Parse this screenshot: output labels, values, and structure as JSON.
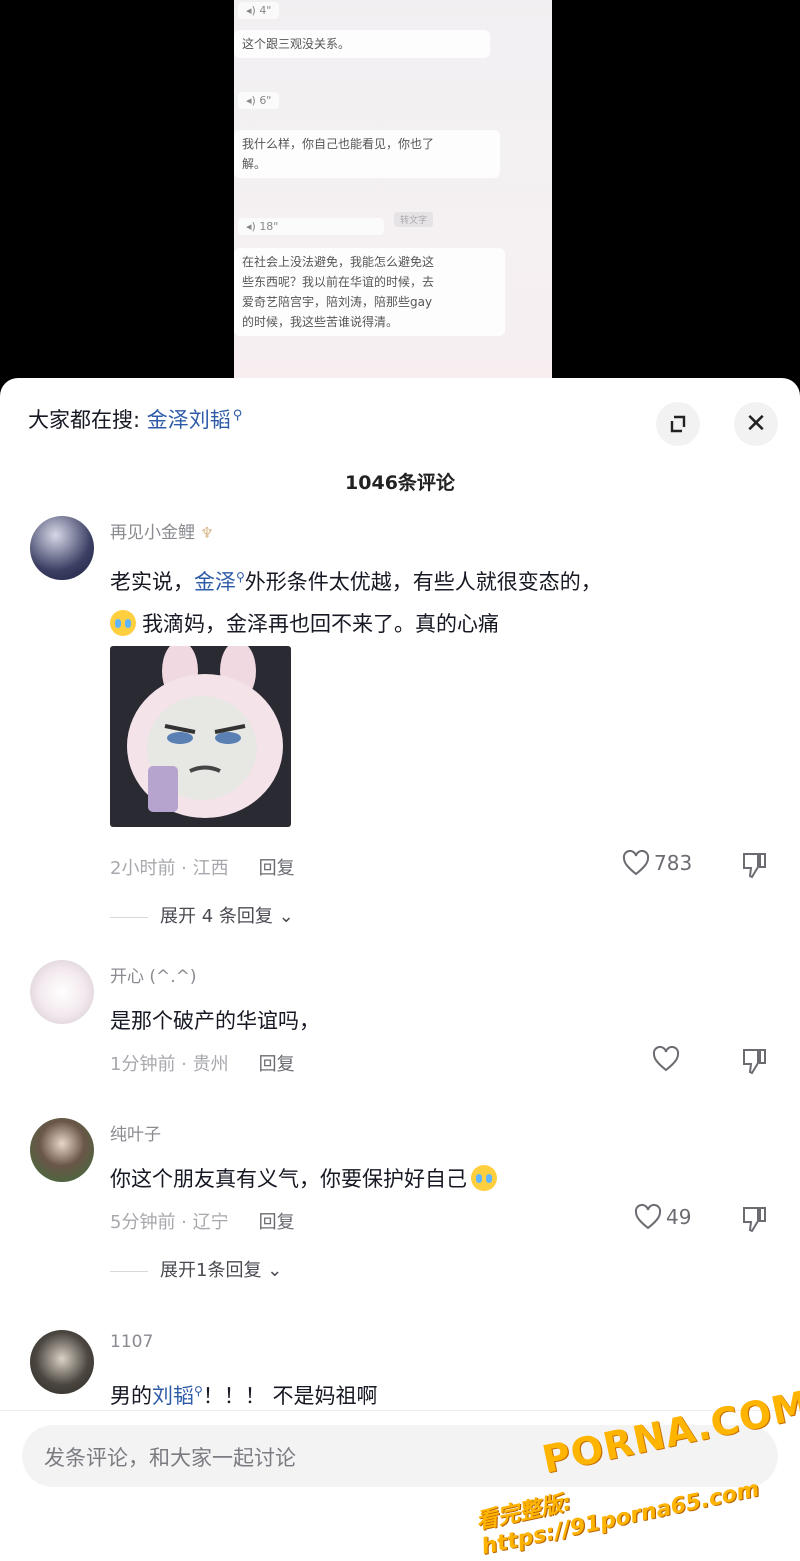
{
  "video": {
    "voice_1": "4\"",
    "msg_1": "这个跟三观没关系。",
    "voice_2": "6\"",
    "msg_2_line1": "我什么样，你自己也能看见，你也了",
    "msg_2_line2": "解。",
    "voice_3": "18\"",
    "tag_3": "转文字",
    "msg_3_line1": "在社会上没法避免，我能怎么避免这",
    "msg_3_line2": "些东西呢？我以前在华谊的时候，去",
    "msg_3_line3": "爱奇艺陪宫宇，陪刘涛，陪那些gay",
    "msg_3_line4": "的时候，我这些苦谁说得清。"
  },
  "header": {
    "search_prefix": "大家都在搜:",
    "search_keyword": "金泽刘韬",
    "comment_count_title": "1046条评论"
  },
  "comments": [
    {
      "username": "再见小金鲤",
      "text_before": "老实说，",
      "text_keyword": "金泽",
      "text_after": "外形条件太优越，有些人就很变态的，",
      "text_line2": "我滴妈，金泽再也回不来了。真的心痛",
      "meta": "2小时前 · 江西",
      "reply_label": "回复",
      "likes": "783",
      "expand_label": "展开 4 条回复"
    },
    {
      "username": "开心 (^.^)",
      "text": "是那个破产的华谊吗，",
      "meta": "1分钟前 · 贵州",
      "reply_label": "回复",
      "likes": ""
    },
    {
      "username": "纯叶子",
      "text": "你这个朋友真有义气，你要保护好自己",
      "meta": "5分钟前 · 辽宁",
      "reply_label": "回复",
      "likes": "49",
      "expand_label": "展开1条回复"
    },
    {
      "username": "1107",
      "text_before": "男的",
      "text_keyword": "刘韬",
      "text_after": "！！！ 不是妈祖啊"
    }
  ],
  "input": {
    "placeholder": "发条评论，和大家一起讨论"
  },
  "watermark": {
    "logo": "PORNA.COM",
    "url": "看完整版: https://91porna65.com"
  },
  "colors": {
    "keyword_blue": "#2e5ba8",
    "watermark_orange": "#ffb400"
  }
}
